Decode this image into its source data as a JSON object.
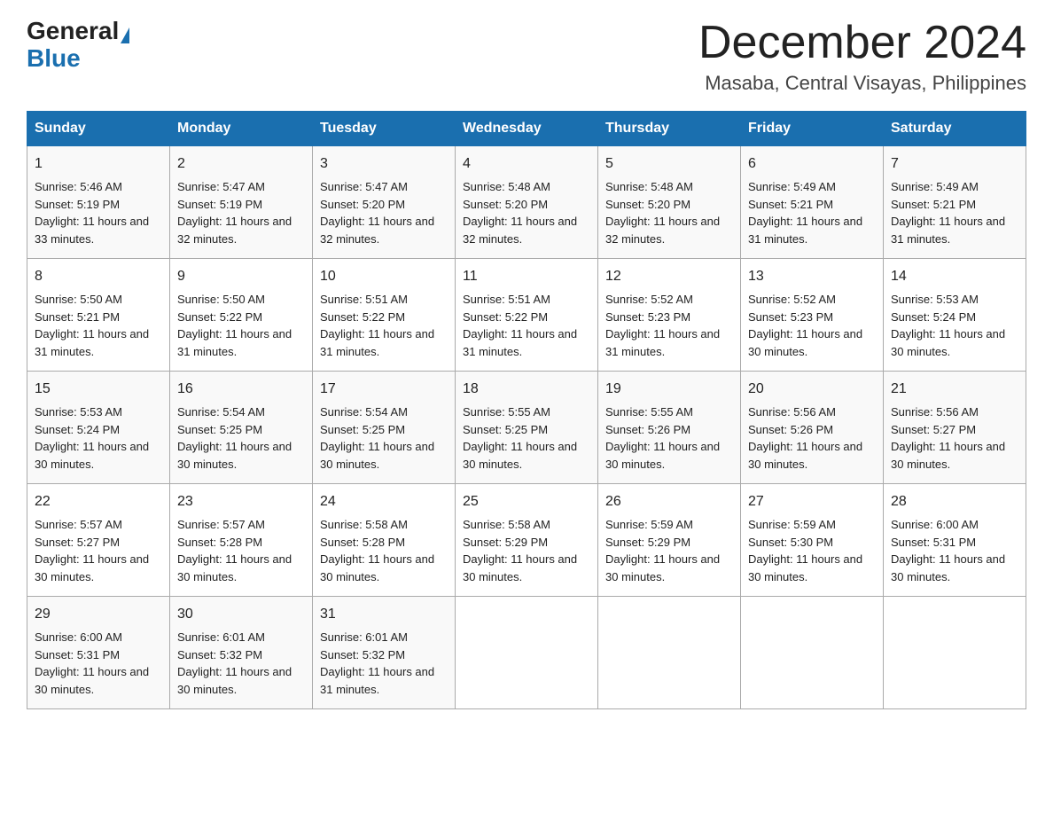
{
  "header": {
    "logo_general": "General",
    "logo_blue": "Blue",
    "month_title": "December 2024",
    "location": "Masaba, Central Visayas, Philippines"
  },
  "days_of_week": [
    "Sunday",
    "Monday",
    "Tuesday",
    "Wednesday",
    "Thursday",
    "Friday",
    "Saturday"
  ],
  "weeks": [
    [
      {
        "day": "1",
        "sunrise": "5:46 AM",
        "sunset": "5:19 PM",
        "daylight": "11 hours and 33 minutes."
      },
      {
        "day": "2",
        "sunrise": "5:47 AM",
        "sunset": "5:19 PM",
        "daylight": "11 hours and 32 minutes."
      },
      {
        "day": "3",
        "sunrise": "5:47 AM",
        "sunset": "5:20 PM",
        "daylight": "11 hours and 32 minutes."
      },
      {
        "day": "4",
        "sunrise": "5:48 AM",
        "sunset": "5:20 PM",
        "daylight": "11 hours and 32 minutes."
      },
      {
        "day": "5",
        "sunrise": "5:48 AM",
        "sunset": "5:20 PM",
        "daylight": "11 hours and 32 minutes."
      },
      {
        "day": "6",
        "sunrise": "5:49 AM",
        "sunset": "5:21 PM",
        "daylight": "11 hours and 31 minutes."
      },
      {
        "day": "7",
        "sunrise": "5:49 AM",
        "sunset": "5:21 PM",
        "daylight": "11 hours and 31 minutes."
      }
    ],
    [
      {
        "day": "8",
        "sunrise": "5:50 AM",
        "sunset": "5:21 PM",
        "daylight": "11 hours and 31 minutes."
      },
      {
        "day": "9",
        "sunrise": "5:50 AM",
        "sunset": "5:22 PM",
        "daylight": "11 hours and 31 minutes."
      },
      {
        "day": "10",
        "sunrise": "5:51 AM",
        "sunset": "5:22 PM",
        "daylight": "11 hours and 31 minutes."
      },
      {
        "day": "11",
        "sunrise": "5:51 AM",
        "sunset": "5:22 PM",
        "daylight": "11 hours and 31 minutes."
      },
      {
        "day": "12",
        "sunrise": "5:52 AM",
        "sunset": "5:23 PM",
        "daylight": "11 hours and 31 minutes."
      },
      {
        "day": "13",
        "sunrise": "5:52 AM",
        "sunset": "5:23 PM",
        "daylight": "11 hours and 30 minutes."
      },
      {
        "day": "14",
        "sunrise": "5:53 AM",
        "sunset": "5:24 PM",
        "daylight": "11 hours and 30 minutes."
      }
    ],
    [
      {
        "day": "15",
        "sunrise": "5:53 AM",
        "sunset": "5:24 PM",
        "daylight": "11 hours and 30 minutes."
      },
      {
        "day": "16",
        "sunrise": "5:54 AM",
        "sunset": "5:25 PM",
        "daylight": "11 hours and 30 minutes."
      },
      {
        "day": "17",
        "sunrise": "5:54 AM",
        "sunset": "5:25 PM",
        "daylight": "11 hours and 30 minutes."
      },
      {
        "day": "18",
        "sunrise": "5:55 AM",
        "sunset": "5:25 PM",
        "daylight": "11 hours and 30 minutes."
      },
      {
        "day": "19",
        "sunrise": "5:55 AM",
        "sunset": "5:26 PM",
        "daylight": "11 hours and 30 minutes."
      },
      {
        "day": "20",
        "sunrise": "5:56 AM",
        "sunset": "5:26 PM",
        "daylight": "11 hours and 30 minutes."
      },
      {
        "day": "21",
        "sunrise": "5:56 AM",
        "sunset": "5:27 PM",
        "daylight": "11 hours and 30 minutes."
      }
    ],
    [
      {
        "day": "22",
        "sunrise": "5:57 AM",
        "sunset": "5:27 PM",
        "daylight": "11 hours and 30 minutes."
      },
      {
        "day": "23",
        "sunrise": "5:57 AM",
        "sunset": "5:28 PM",
        "daylight": "11 hours and 30 minutes."
      },
      {
        "day": "24",
        "sunrise": "5:58 AM",
        "sunset": "5:28 PM",
        "daylight": "11 hours and 30 minutes."
      },
      {
        "day": "25",
        "sunrise": "5:58 AM",
        "sunset": "5:29 PM",
        "daylight": "11 hours and 30 minutes."
      },
      {
        "day": "26",
        "sunrise": "5:59 AM",
        "sunset": "5:29 PM",
        "daylight": "11 hours and 30 minutes."
      },
      {
        "day": "27",
        "sunrise": "5:59 AM",
        "sunset": "5:30 PM",
        "daylight": "11 hours and 30 minutes."
      },
      {
        "day": "28",
        "sunrise": "6:00 AM",
        "sunset": "5:31 PM",
        "daylight": "11 hours and 30 minutes."
      }
    ],
    [
      {
        "day": "29",
        "sunrise": "6:00 AM",
        "sunset": "5:31 PM",
        "daylight": "11 hours and 30 minutes."
      },
      {
        "day": "30",
        "sunrise": "6:01 AM",
        "sunset": "5:32 PM",
        "daylight": "11 hours and 30 minutes."
      },
      {
        "day": "31",
        "sunrise": "6:01 AM",
        "sunset": "5:32 PM",
        "daylight": "11 hours and 31 minutes."
      },
      null,
      null,
      null,
      null
    ]
  ],
  "labels": {
    "sunrise_prefix": "Sunrise: ",
    "sunset_prefix": "Sunset: ",
    "daylight_prefix": "Daylight: "
  }
}
